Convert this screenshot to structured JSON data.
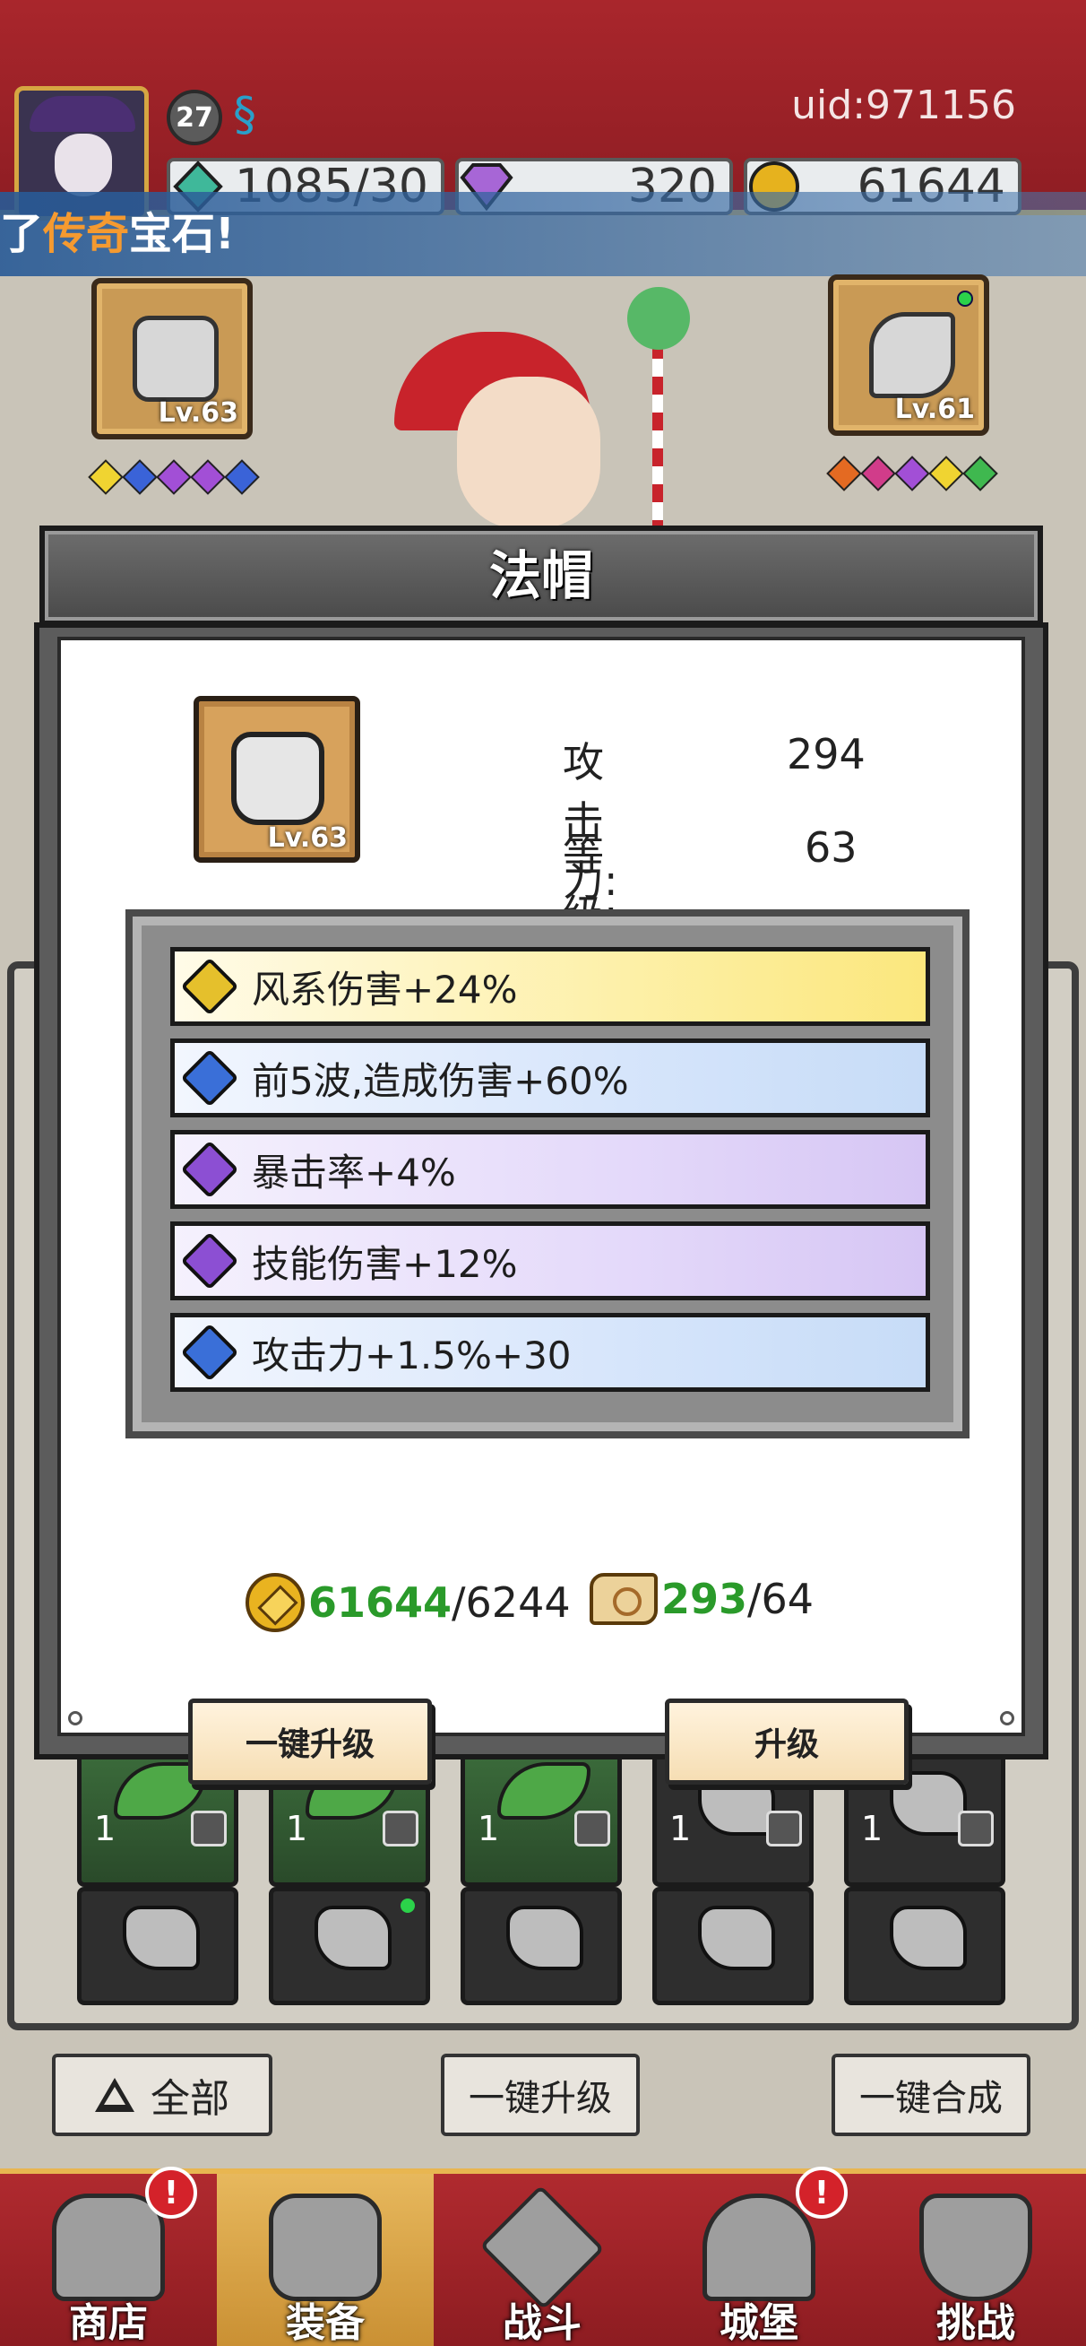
{
  "header": {
    "uid": "uid:971156",
    "player_level": "27",
    "resources": {
      "energy": "1085/30",
      "diamonds": "320",
      "gold": "61644"
    }
  },
  "marquee": {
    "prefix": "了",
    "highlight": "传奇",
    "suffix": "宝石!"
  },
  "equipment": {
    "left_slot_level": "Lv.63",
    "right_slot_level": "Lv.61"
  },
  "modal": {
    "title": "法帽",
    "item_level_badge": "Lv.63",
    "attack_label": "攻击力:",
    "attack_value": "294",
    "level_label": "等　级:",
    "level_value": "63",
    "gems": [
      {
        "text": "风系伤害+24%",
        "color": "yellow"
      },
      {
        "text": "前5波,造成伤害+60%",
        "color": "blue"
      },
      {
        "text": "暴击率+4%",
        "color": "purple"
      },
      {
        "text": "技能伤害+12%",
        "color": "purple"
      },
      {
        "text": "攻击力+1.5%+30",
        "color": "blue"
      }
    ],
    "cost_gold_have": "61644",
    "cost_gold_need": "/6244",
    "cost_scroll_have": "293",
    "cost_scroll_need": "/64",
    "btn_upgrade_all": "一键升级",
    "btn_upgrade": "升级"
  },
  "inventory": {
    "cells_row1": [
      {
        "qty": "1"
      },
      {
        "qty": "1"
      },
      {
        "qty": "1"
      },
      {
        "qty": "1"
      },
      {
        "qty": "1"
      }
    ]
  },
  "filters": {
    "all": "全部",
    "upgrade_all": "一键升级",
    "merge_all": "一键合成"
  },
  "nav": {
    "shop": "商店",
    "equipment": "装备",
    "battle": "战斗",
    "castle": "城堡",
    "challenge": "挑战",
    "alert_mark": "!"
  },
  "colors": {
    "top_band": "#a9262c",
    "accent_gold": "#e8b651",
    "have_green": "#2a9a2a"
  }
}
